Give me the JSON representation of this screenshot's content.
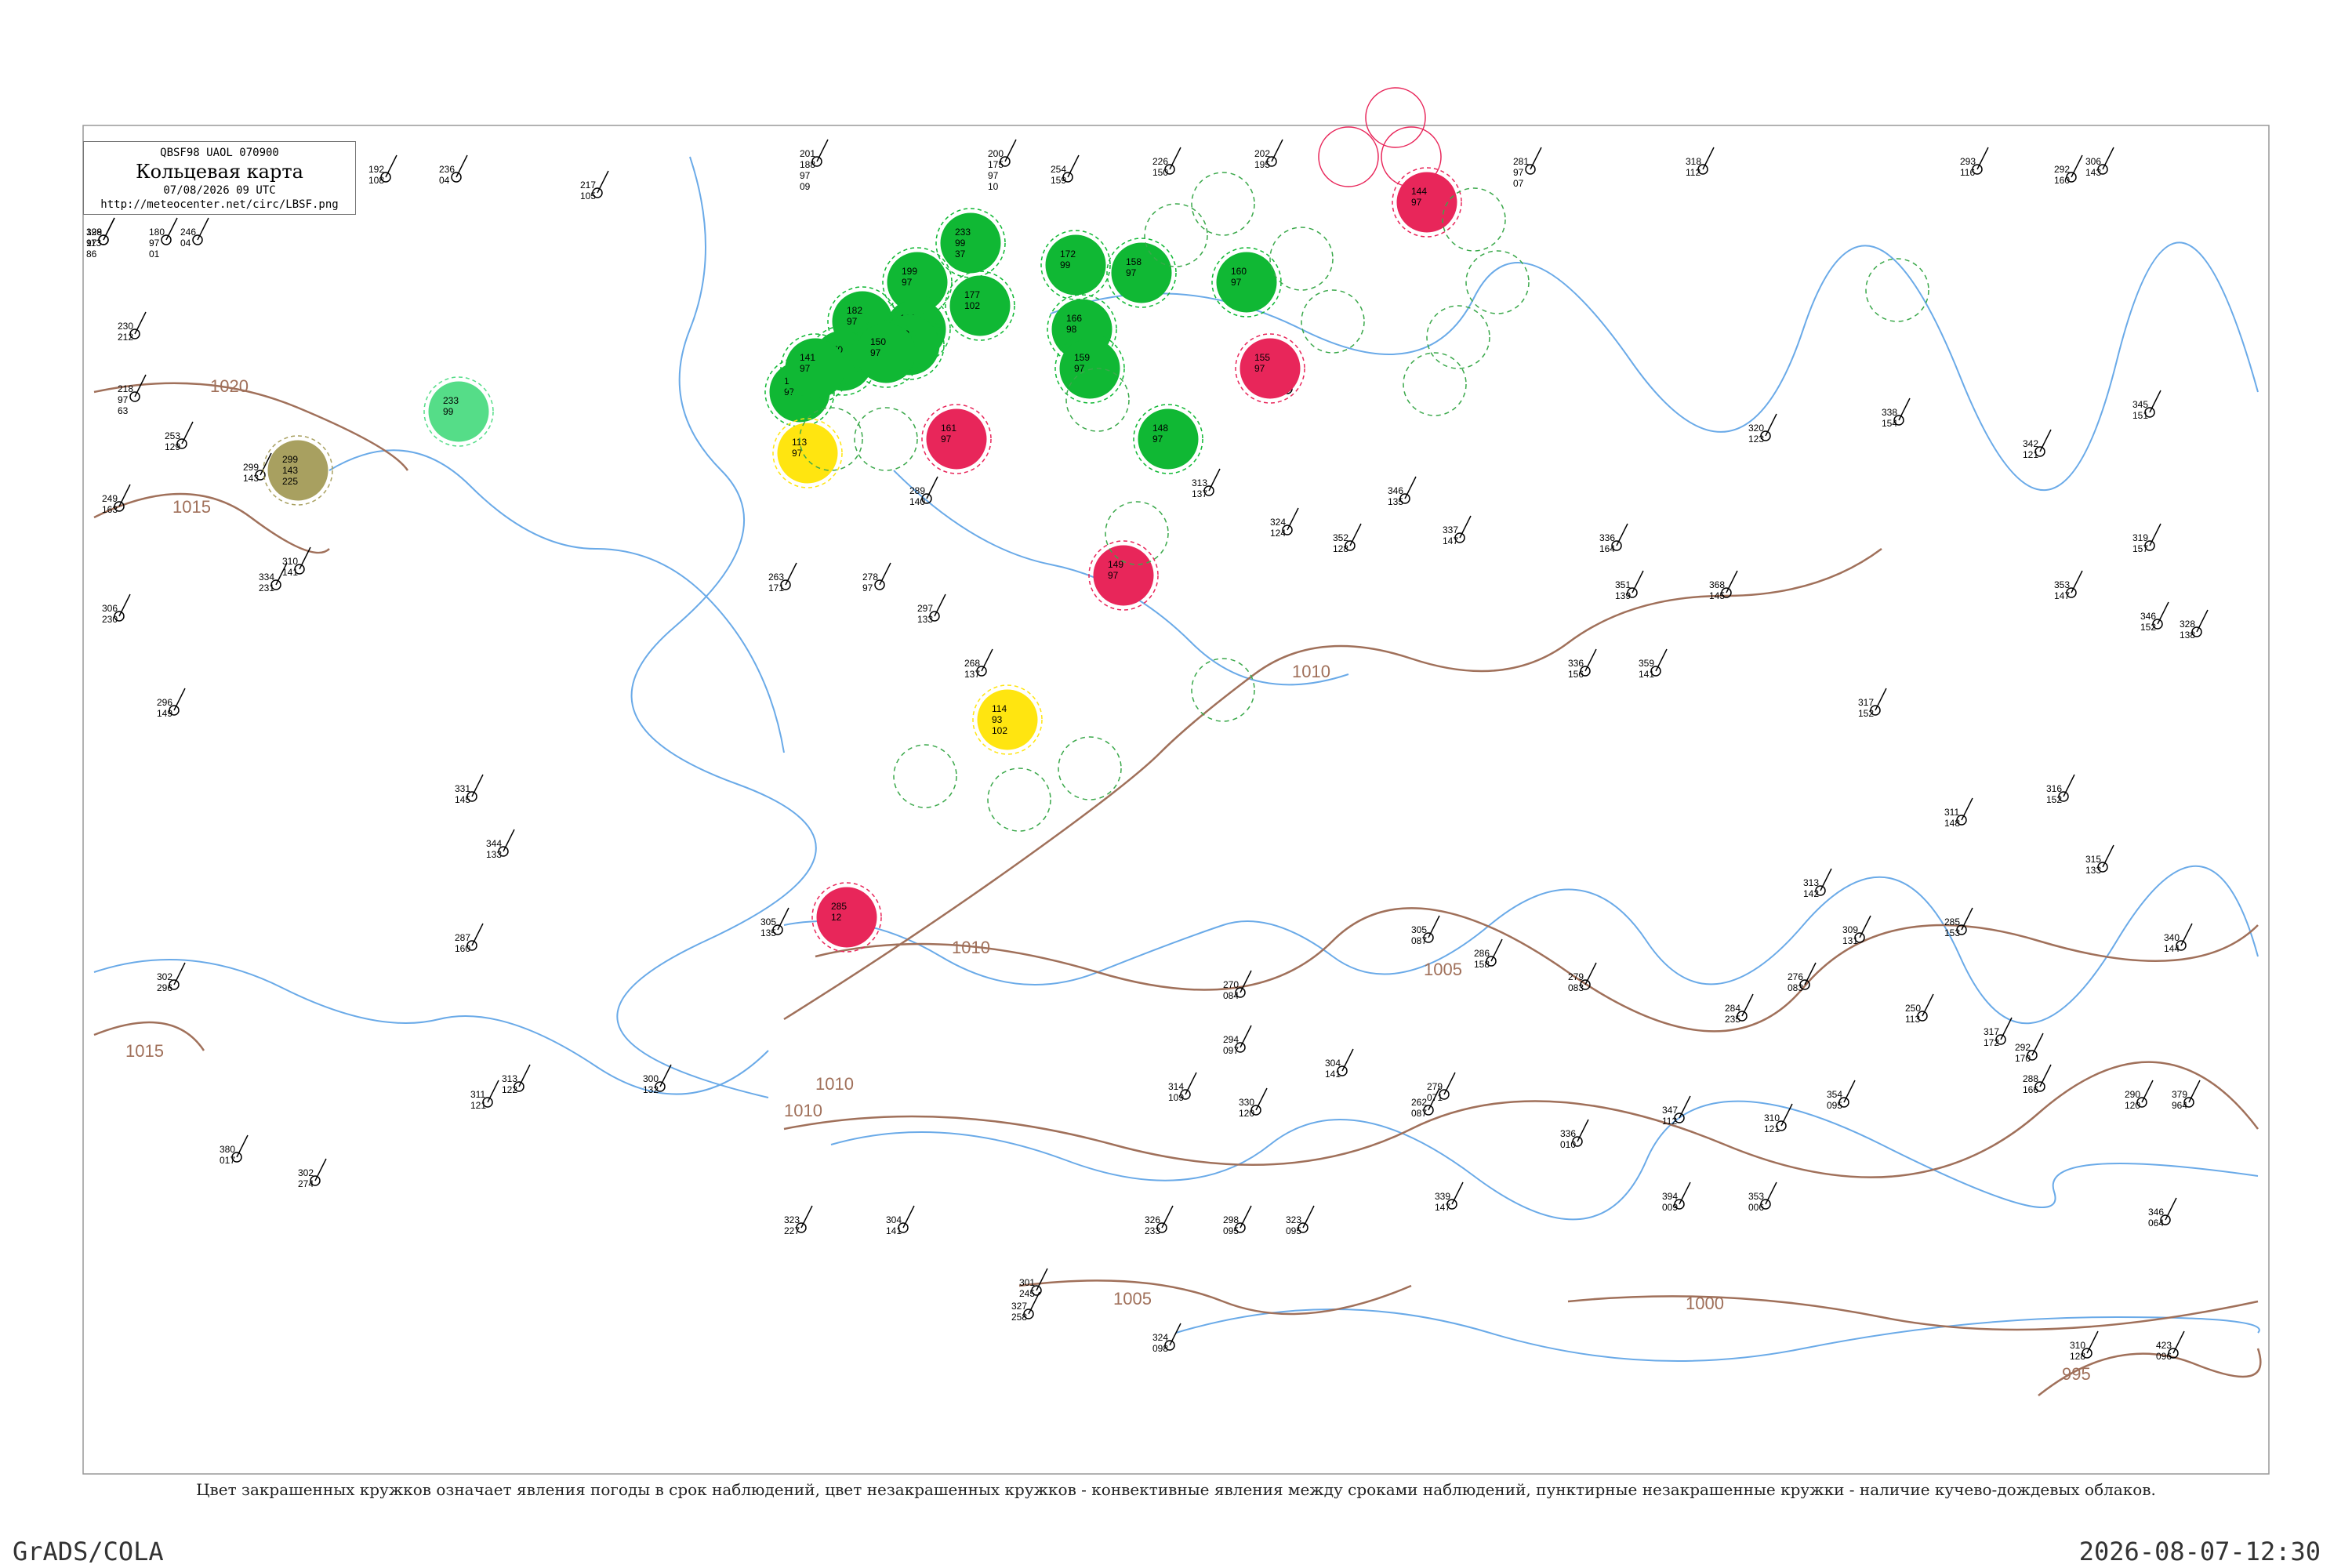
{
  "header": {
    "code": "QBSF98 UAOL 070900",
    "title": "Кольцевая карта",
    "datetime": "07/08/2026 09 UTC",
    "url": "http://meteocenter.net/circ/LBSF.png"
  },
  "caption": "Цвет закрашенных кружков означает явления погоды в срок наблюдений, цвет незакрашенных кружков - конвективные явления между сроками наблюдений, пунктирные незакрашенные кружки - наличие кучево-дождевых облаков.",
  "footer": {
    "software": "GrADS/COLA",
    "timestamp": "2026-08-07-12:30"
  },
  "isobars": [
    "1020",
    "1015",
    "1010",
    "1010",
    "1010",
    "1010",
    "1005",
    "1005",
    "1000",
    "995",
    "1015"
  ],
  "colors": {
    "green": "#10b834",
    "red": "#e8265a",
    "yellow": "#ffe510",
    "olive": "#a8a060",
    "lightgreen": "#55dd88",
    "isobar": "#a0705a",
    "water": "#6aaae8"
  },
  "stations": [
    {
      "labels": [
        "199",
        "97",
        "86"
      ]
    },
    {
      "labels": [
        "180",
        "97",
        "01"
      ]
    },
    {
      "labels": [
        "246",
        "04"
      ]
    },
    {
      "labels": [
        "192",
        "108"
      ]
    },
    {
      "labels": [
        "236",
        "04"
      ]
    },
    {
      "labels": [
        "217",
        "105"
      ]
    },
    {
      "labels": [
        "201",
        "188",
        "97",
        "09"
      ]
    },
    {
      "labels": [
        "200",
        "175",
        "97",
        "10"
      ]
    },
    {
      "labels": [
        "254",
        "159"
      ]
    },
    {
      "labels": [
        "226",
        "150"
      ]
    },
    {
      "labels": [
        "202",
        "195"
      ]
    },
    {
      "labels": [
        "281",
        "97",
        "07"
      ]
    },
    {
      "labels": [
        "318",
        "112"
      ]
    },
    {
      "labels": [
        "293",
        "116"
      ]
    },
    {
      "labels": [
        "306",
        "143"
      ]
    },
    {
      "labels": [
        "292",
        "160"
      ]
    },
    {
      "labels": [
        "230",
        "212"
      ]
    },
    {
      "labels": [
        "218",
        "97",
        "63"
      ]
    },
    {
      "labels": [
        "253",
        "129"
      ]
    },
    {
      "labels": [
        "249",
        "163"
      ]
    },
    {
      "labels": [
        "306",
        "230"
      ]
    },
    {
      "labels": [
        "296",
        "149"
      ]
    },
    {
      "labels": [
        "302",
        "296"
      ]
    },
    {
      "labels": [
        "334",
        "231"
      ]
    },
    {
      "labels": [
        "310",
        "141"
      ]
    },
    {
      "labels": [
        "299",
        "143"
      ]
    },
    {
      "labels": [
        "331",
        "145"
      ]
    },
    {
      "labels": [
        "344",
        "133"
      ]
    },
    {
      "labels": [
        "287",
        "160"
      ]
    },
    {
      "labels": [
        "313",
        "122"
      ]
    },
    {
      "labels": [
        "300",
        "132"
      ]
    },
    {
      "labels": [
        "305",
        "135"
      ]
    },
    {
      "labels": [
        "311",
        "121"
      ]
    },
    {
      "labels": [
        "302",
        "274"
      ]
    },
    {
      "labels": [
        "289",
        "140"
      ]
    },
    {
      "labels": [
        "263",
        "171"
      ]
    },
    {
      "labels": [
        "278",
        "97"
      ]
    },
    {
      "labels": [
        "297",
        "133"
      ]
    },
    {
      "labels": [
        "268",
        "137"
      ]
    },
    {
      "labels": [
        "313",
        "137"
      ]
    },
    {
      "labels": [
        "324",
        "124"
      ]
    },
    {
      "labels": [
        "331",
        "119"
      ]
    },
    {
      "labels": [
        "352",
        "128"
      ]
    },
    {
      "labels": [
        "346",
        "135"
      ]
    },
    {
      "labels": [
        "337",
        "147"
      ]
    },
    {
      "labels": [
        "336",
        "164"
      ]
    },
    {
      "labels": [
        "351",
        "139"
      ]
    },
    {
      "labels": [
        "359",
        "141"
      ]
    },
    {
      "labels": [
        "368",
        "145"
      ]
    },
    {
      "labels": [
        "320",
        "123"
      ]
    },
    {
      "labels": [
        "338",
        "154"
      ]
    },
    {
      "labels": [
        "342",
        "121"
      ]
    },
    {
      "labels": [
        "345",
        "151"
      ]
    },
    {
      "labels": [
        "353",
        "147"
      ]
    },
    {
      "labels": [
        "319",
        "157"
      ]
    },
    {
      "labels": [
        "346",
        "152"
      ]
    },
    {
      "labels": [
        "328",
        "138"
      ]
    },
    {
      "labels": [
        "316",
        "152"
      ]
    },
    {
      "labels": [
        "336",
        "156"
      ]
    },
    {
      "labels": [
        "317",
        "152"
      ]
    },
    {
      "labels": [
        "311",
        "148"
      ]
    },
    {
      "labels": [
        "315",
        "133"
      ]
    },
    {
      "labels": [
        "313",
        "142"
      ]
    },
    {
      "labels": [
        "285",
        "153"
      ]
    },
    {
      "labels": [
        "309",
        "131"
      ]
    },
    {
      "labels": [
        "305",
        "087"
      ]
    },
    {
      "labels": [
        "286",
        "158"
      ]
    },
    {
      "labels": [
        "279",
        "083"
      ]
    },
    {
      "labels": [
        "276",
        "083"
      ]
    },
    {
      "labels": [
        "284",
        "235"
      ]
    },
    {
      "labels": [
        "250",
        "113"
      ]
    },
    {
      "labels": [
        "340",
        "144"
      ]
    },
    {
      "labels": [
        "317",
        "172"
      ]
    },
    {
      "labels": [
        "292",
        "170"
      ]
    },
    {
      "labels": [
        "288",
        "166"
      ]
    },
    {
      "labels": [
        "290",
        "120"
      ]
    },
    {
      "labels": [
        "270",
        "084"
      ]
    },
    {
      "labels": [
        "294",
        "097"
      ]
    },
    {
      "labels": [
        "279",
        "071"
      ]
    },
    {
      "labels": [
        "304",
        "141"
      ]
    },
    {
      "labels": [
        "262",
        "087"
      ]
    },
    {
      "labels": [
        "347",
        "112"
      ]
    },
    {
      "labels": [
        "310",
        "121"
      ]
    },
    {
      "labels": [
        "336",
        "010"
      ]
    },
    {
      "labels": [
        "394",
        "009"
      ]
    },
    {
      "labels": [
        "353",
        "006"
      ]
    },
    {
      "labels": [
        "354",
        "095"
      ]
    },
    {
      "labels": [
        "346",
        "064"
      ]
    },
    {
      "labels": [
        "380",
        "017"
      ]
    },
    {
      "labels": [
        "323",
        "227"
      ]
    },
    {
      "labels": [
        "304",
        "141"
      ]
    },
    {
      "labels": [
        "301",
        "245"
      ]
    },
    {
      "labels": [
        "327",
        "258"
      ]
    },
    {
      "labels": [
        "326",
        "233"
      ]
    },
    {
      "labels": [
        "324",
        "098"
      ]
    },
    {
      "labels": [
        "323",
        "095"
      ]
    },
    {
      "labels": [
        "339",
        "147"
      ]
    },
    {
      "labels": [
        "330",
        "120"
      ]
    },
    {
      "labels": [
        "314",
        "109"
      ]
    },
    {
      "labels": [
        "298",
        "095"
      ]
    },
    {
      "labels": [
        "310",
        "128"
      ]
    },
    {
      "labels": [
        "423",
        "096"
      ]
    },
    {
      "labels": [
        "379",
        "964"
      ]
    },
    {
      "labels": [
        "328",
        "113"
      ]
    }
  ],
  "filled_circles": [
    {
      "color": "green",
      "labels": [
        "233",
        "99",
        "37"
      ]
    },
    {
      "color": "green",
      "labels": [
        "199",
        "97"
      ]
    },
    {
      "color": "green",
      "labels": [
        "177",
        "102"
      ]
    },
    {
      "color": "green",
      "labels": [
        "169",
        "97"
      ]
    },
    {
      "color": "green",
      "labels": [
        "182",
        "97"
      ]
    },
    {
      "color": "green",
      "labels": [
        "179",
        "110"
      ]
    },
    {
      "color": "green",
      "labels": [
        "170",
        "99"
      ]
    },
    {
      "color": "green",
      "labels": [
        "163",
        "97"
      ]
    },
    {
      "color": "green",
      "labels": [
        "172",
        "99"
      ]
    },
    {
      "color": "green",
      "labels": [
        "158",
        "97"
      ]
    },
    {
      "color": "green",
      "labels": [
        "160",
        "97"
      ]
    },
    {
      "color": "green",
      "labels": [
        "166",
        "98"
      ]
    },
    {
      "color": "green",
      "labels": [
        "159",
        "97"
      ]
    },
    {
      "color": "green",
      "labels": [
        "148",
        "97"
      ]
    },
    {
      "color": "green",
      "labels": [
        "141",
        "97"
      ]
    },
    {
      "color": "green",
      "labels": [
        "150",
        "97"
      ]
    },
    {
      "color": "red",
      "labels": [
        "161",
        "97"
      ]
    },
    {
      "color": "red",
      "labels": [
        "155",
        "97"
      ]
    },
    {
      "color": "red",
      "labels": [
        "149",
        "97"
      ]
    },
    {
      "color": "red",
      "labels": [
        "144",
        "97"
      ]
    },
    {
      "color": "red",
      "labels": [
        "285",
        "12"
      ]
    },
    {
      "color": "yellow",
      "labels": [
        "113",
        "97"
      ]
    },
    {
      "color": "yellow",
      "labels": [
        "114",
        "93",
        "102"
      ]
    },
    {
      "color": "olive",
      "labels": [
        "299",
        "143",
        "225"
      ]
    },
    {
      "color": "lightgreen",
      "labels": [
        "233",
        "99"
      ]
    }
  ]
}
